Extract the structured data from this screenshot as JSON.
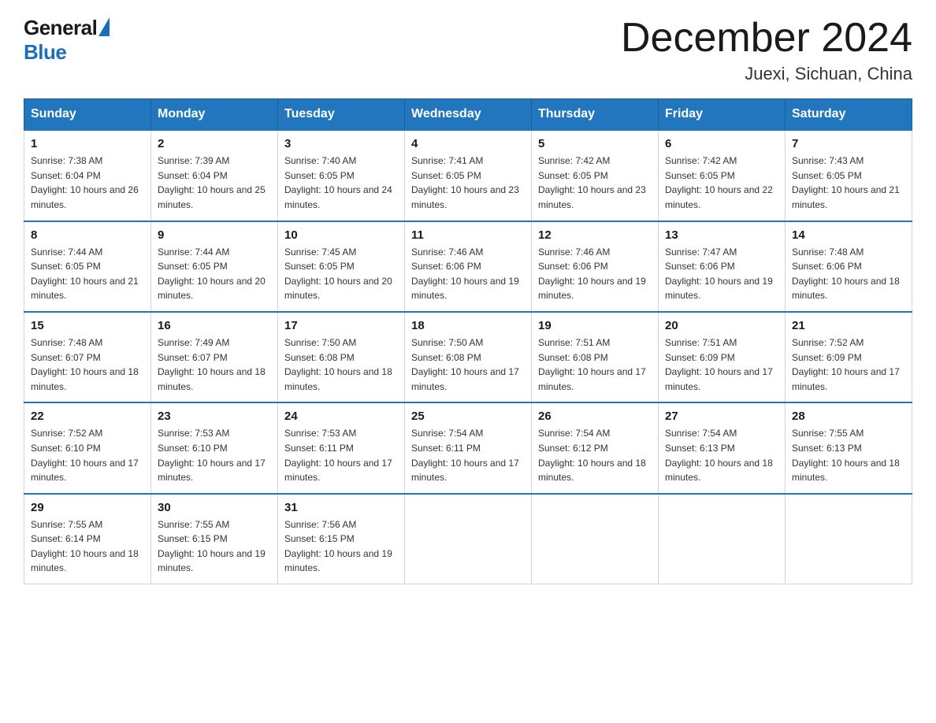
{
  "header": {
    "logo_general": "General",
    "logo_blue": "Blue",
    "title": "December 2024",
    "location": "Juexi, Sichuan, China"
  },
  "days_of_week": [
    "Sunday",
    "Monday",
    "Tuesday",
    "Wednesday",
    "Thursday",
    "Friday",
    "Saturday"
  ],
  "weeks": [
    [
      {
        "day": "1",
        "sunrise": "7:38 AM",
        "sunset": "6:04 PM",
        "daylight": "10 hours and 26 minutes."
      },
      {
        "day": "2",
        "sunrise": "7:39 AM",
        "sunset": "6:04 PM",
        "daylight": "10 hours and 25 minutes."
      },
      {
        "day": "3",
        "sunrise": "7:40 AM",
        "sunset": "6:05 PM",
        "daylight": "10 hours and 24 minutes."
      },
      {
        "day": "4",
        "sunrise": "7:41 AM",
        "sunset": "6:05 PM",
        "daylight": "10 hours and 23 minutes."
      },
      {
        "day": "5",
        "sunrise": "7:42 AM",
        "sunset": "6:05 PM",
        "daylight": "10 hours and 23 minutes."
      },
      {
        "day": "6",
        "sunrise": "7:42 AM",
        "sunset": "6:05 PM",
        "daylight": "10 hours and 22 minutes."
      },
      {
        "day": "7",
        "sunrise": "7:43 AM",
        "sunset": "6:05 PM",
        "daylight": "10 hours and 21 minutes."
      }
    ],
    [
      {
        "day": "8",
        "sunrise": "7:44 AM",
        "sunset": "6:05 PM",
        "daylight": "10 hours and 21 minutes."
      },
      {
        "day": "9",
        "sunrise": "7:44 AM",
        "sunset": "6:05 PM",
        "daylight": "10 hours and 20 minutes."
      },
      {
        "day": "10",
        "sunrise": "7:45 AM",
        "sunset": "6:05 PM",
        "daylight": "10 hours and 20 minutes."
      },
      {
        "day": "11",
        "sunrise": "7:46 AM",
        "sunset": "6:06 PM",
        "daylight": "10 hours and 19 minutes."
      },
      {
        "day": "12",
        "sunrise": "7:46 AM",
        "sunset": "6:06 PM",
        "daylight": "10 hours and 19 minutes."
      },
      {
        "day": "13",
        "sunrise": "7:47 AM",
        "sunset": "6:06 PM",
        "daylight": "10 hours and 19 minutes."
      },
      {
        "day": "14",
        "sunrise": "7:48 AM",
        "sunset": "6:06 PM",
        "daylight": "10 hours and 18 minutes."
      }
    ],
    [
      {
        "day": "15",
        "sunrise": "7:48 AM",
        "sunset": "6:07 PM",
        "daylight": "10 hours and 18 minutes."
      },
      {
        "day": "16",
        "sunrise": "7:49 AM",
        "sunset": "6:07 PM",
        "daylight": "10 hours and 18 minutes."
      },
      {
        "day": "17",
        "sunrise": "7:50 AM",
        "sunset": "6:08 PM",
        "daylight": "10 hours and 18 minutes."
      },
      {
        "day": "18",
        "sunrise": "7:50 AM",
        "sunset": "6:08 PM",
        "daylight": "10 hours and 17 minutes."
      },
      {
        "day": "19",
        "sunrise": "7:51 AM",
        "sunset": "6:08 PM",
        "daylight": "10 hours and 17 minutes."
      },
      {
        "day": "20",
        "sunrise": "7:51 AM",
        "sunset": "6:09 PM",
        "daylight": "10 hours and 17 minutes."
      },
      {
        "day": "21",
        "sunrise": "7:52 AM",
        "sunset": "6:09 PM",
        "daylight": "10 hours and 17 minutes."
      }
    ],
    [
      {
        "day": "22",
        "sunrise": "7:52 AM",
        "sunset": "6:10 PM",
        "daylight": "10 hours and 17 minutes."
      },
      {
        "day": "23",
        "sunrise": "7:53 AM",
        "sunset": "6:10 PM",
        "daylight": "10 hours and 17 minutes."
      },
      {
        "day": "24",
        "sunrise": "7:53 AM",
        "sunset": "6:11 PM",
        "daylight": "10 hours and 17 minutes."
      },
      {
        "day": "25",
        "sunrise": "7:54 AM",
        "sunset": "6:11 PM",
        "daylight": "10 hours and 17 minutes."
      },
      {
        "day": "26",
        "sunrise": "7:54 AM",
        "sunset": "6:12 PM",
        "daylight": "10 hours and 18 minutes."
      },
      {
        "day": "27",
        "sunrise": "7:54 AM",
        "sunset": "6:13 PM",
        "daylight": "10 hours and 18 minutes."
      },
      {
        "day": "28",
        "sunrise": "7:55 AM",
        "sunset": "6:13 PM",
        "daylight": "10 hours and 18 minutes."
      }
    ],
    [
      {
        "day": "29",
        "sunrise": "7:55 AM",
        "sunset": "6:14 PM",
        "daylight": "10 hours and 18 minutes."
      },
      {
        "day": "30",
        "sunrise": "7:55 AM",
        "sunset": "6:15 PM",
        "daylight": "10 hours and 19 minutes."
      },
      {
        "day": "31",
        "sunrise": "7:56 AM",
        "sunset": "6:15 PM",
        "daylight": "10 hours and 19 minutes."
      },
      null,
      null,
      null,
      null
    ]
  ]
}
